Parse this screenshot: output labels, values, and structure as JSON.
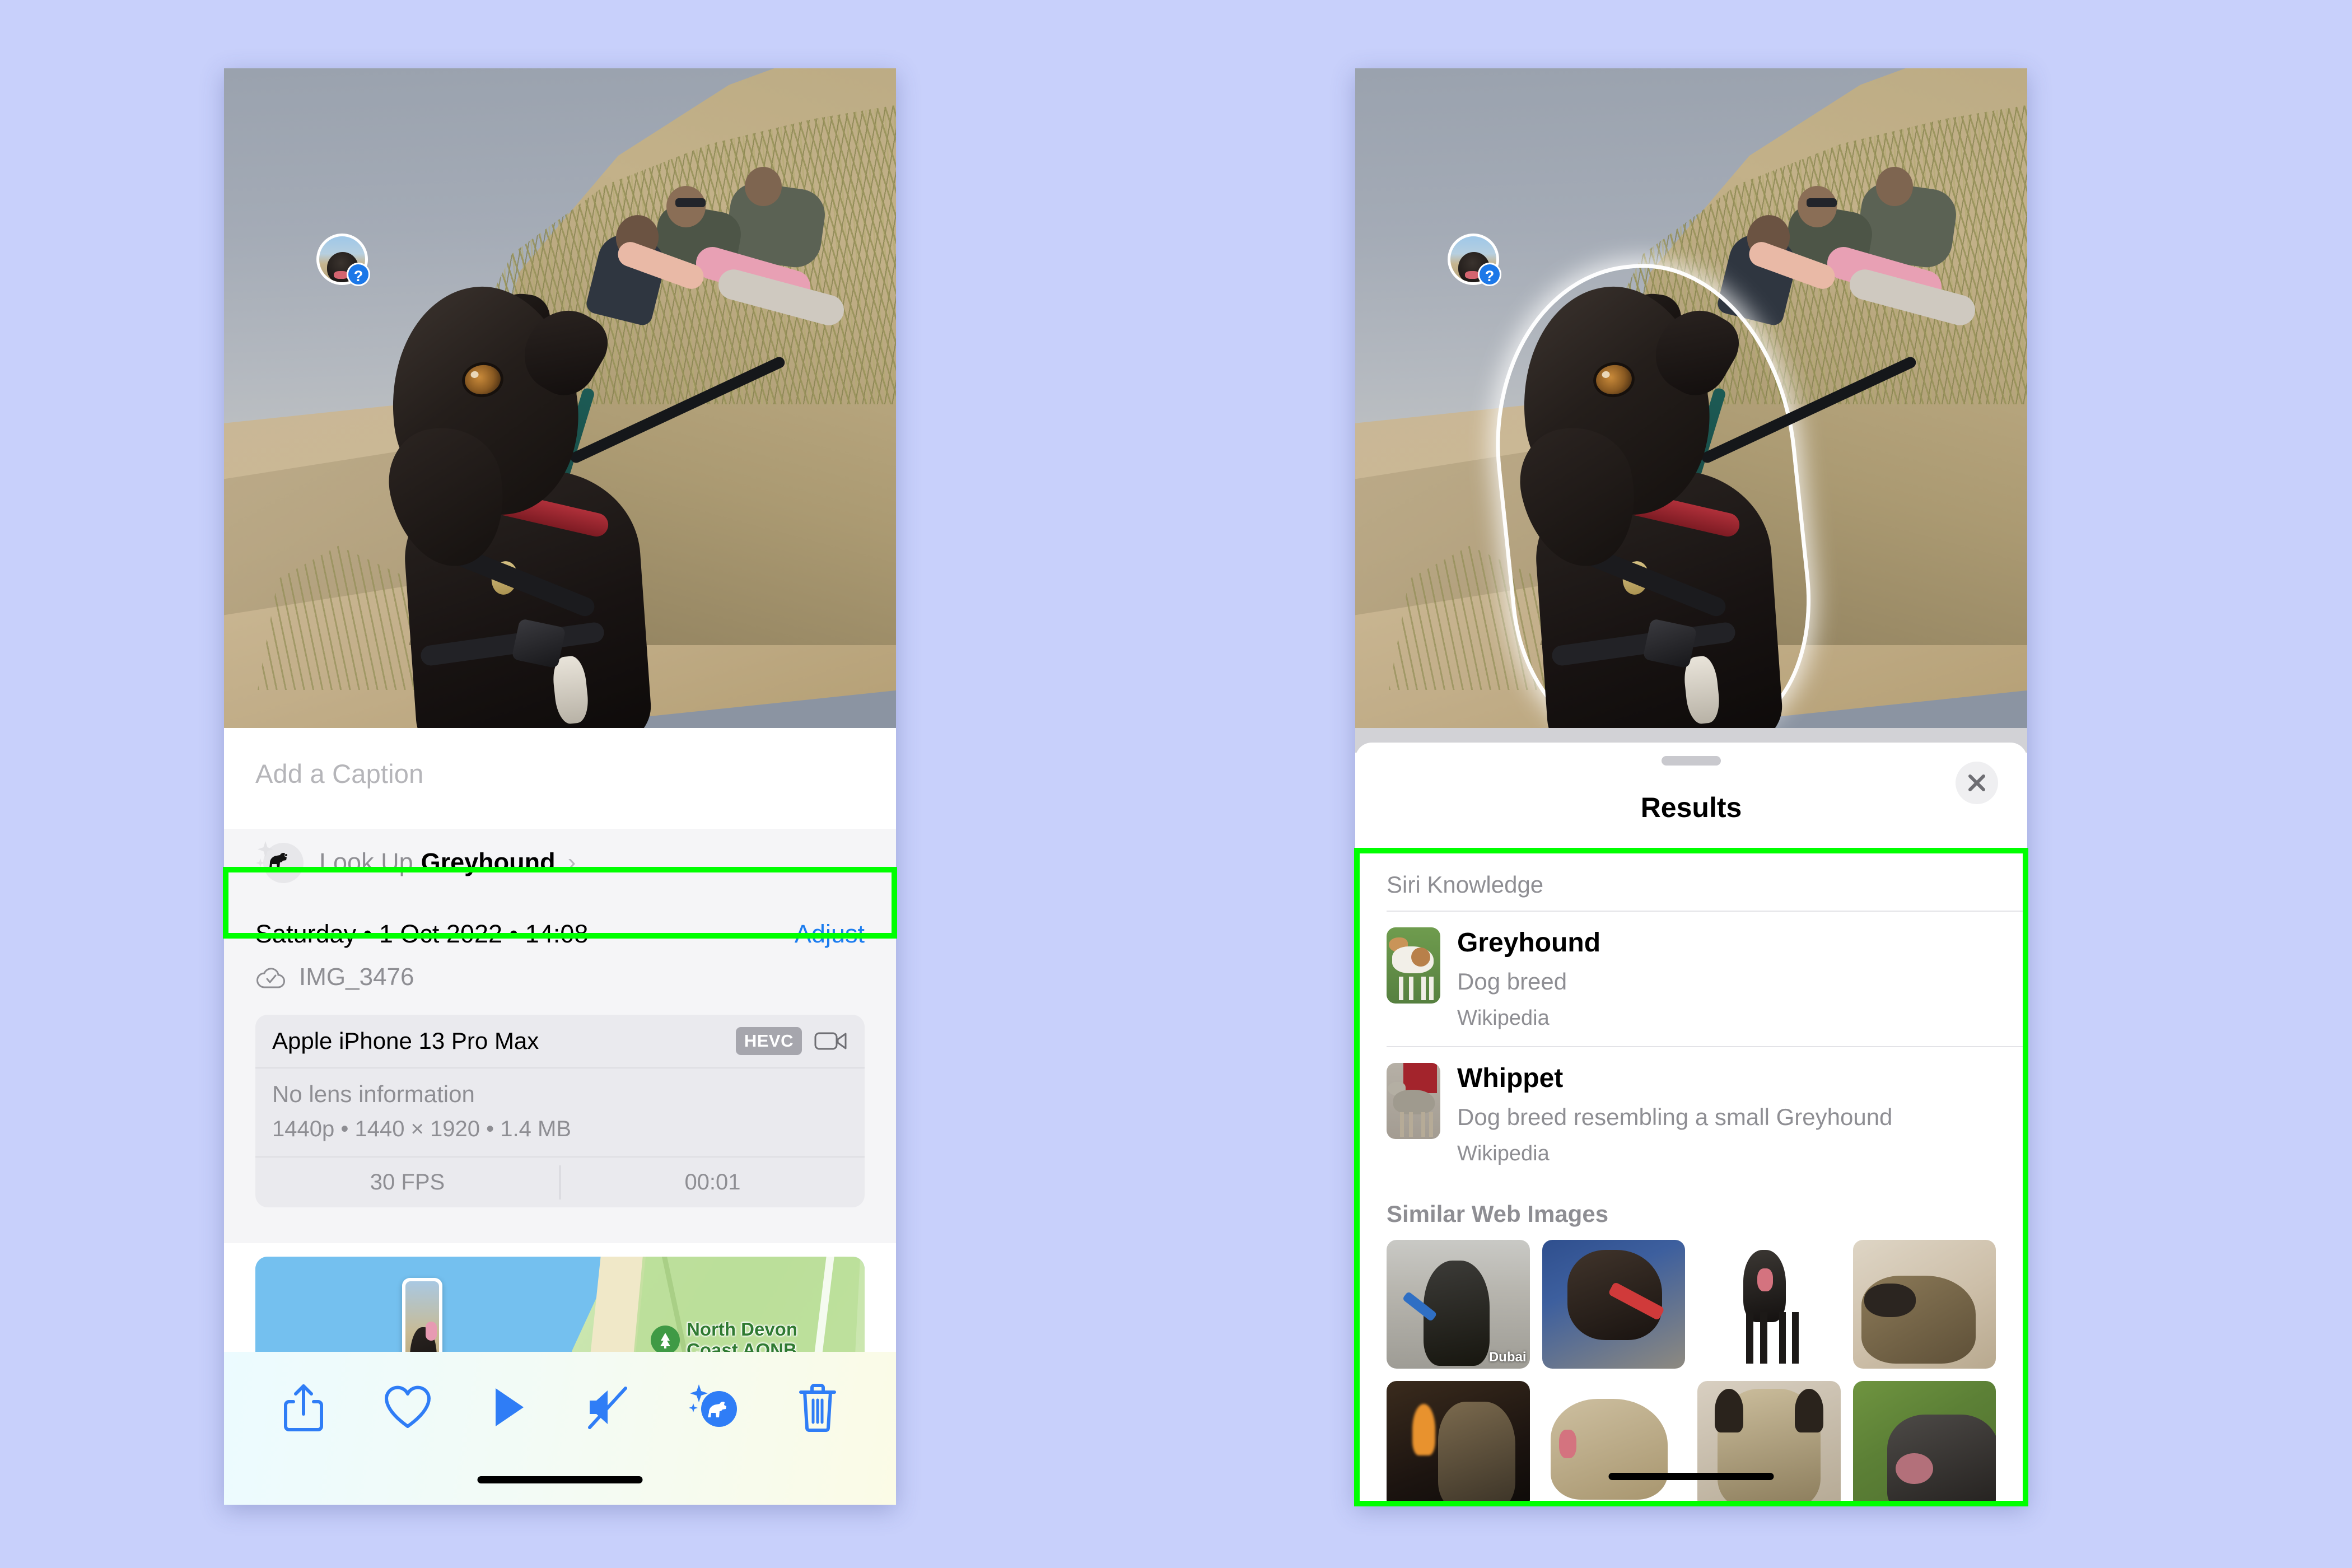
{
  "background_color": "#c8d0fb",
  "highlight_color": "#00ff00",
  "accent_color": "#1b7cef",
  "left_phone": {
    "photo": {
      "pet_badge": {
        "icon": "pet-face-avatar",
        "badge_glyph": "?"
      }
    },
    "caption": {
      "placeholder": "Add a Caption",
      "value": ""
    },
    "look_up": {
      "icon": "dog-sparkle-icon",
      "prefix_label": "Look Up ",
      "subject_label": "Greyhound",
      "chevron": "›"
    },
    "meta": {
      "date_line": "Saturday • 1 Oct 2022 • 14:08",
      "adjust_label": "Adjust",
      "cloud_icon": "icloud-check-icon",
      "filename": "IMG_3476",
      "device_card": {
        "device": "Apple iPhone 13 Pro Max",
        "codec_badge": "HEVC",
        "media_icon": "video-camera-icon",
        "lens_info": "No lens information",
        "resolution_line": "1440p • 1440 × 1920 • 1.4 MB",
        "fps": "30 FPS",
        "duration": "00:01"
      }
    },
    "map": {
      "poi_label": "North Devon\nCoast AONB",
      "poi_icon": "national-park-tree-icon",
      "thumb_alt": "photo-location-thumbnail"
    },
    "toolbar": {
      "items": [
        {
          "name": "share-icon",
          "label": "Share"
        },
        {
          "name": "heart-icon",
          "label": "Favourite"
        },
        {
          "name": "play-icon",
          "label": "Play"
        },
        {
          "name": "speaker-mute-icon",
          "label": "Mute"
        },
        {
          "name": "visual-look-up-dog-icon",
          "label": "Visual Look Up"
        },
        {
          "name": "trash-icon",
          "label": "Delete"
        }
      ],
      "home_indicator": "home-indicator"
    }
  },
  "right_phone": {
    "sheet": {
      "grabber": "sheet-grabber",
      "title": "Results",
      "close_icon": "close-icon"
    },
    "siri_knowledge": {
      "section_title": "Siri Knowledge",
      "rows": [
        {
          "title": "Greyhound",
          "subtitle": "Dog breed",
          "source": "Wikipedia",
          "thumb": "greyhound-standing-on-grass"
        },
        {
          "title": "Whippet",
          "subtitle": "Dog breed resembling a small Greyhound",
          "source": "Wikipedia",
          "thumb": "whippet-standing-on-track"
        }
      ]
    },
    "similar_web_images": {
      "section_title": "Similar Web Images",
      "items": [
        {
          "alt": "black-greyhound-on-blue-lead",
          "caption": "Dubai"
        },
        {
          "alt": "greyhound-with-red-collar-on-mat",
          "caption": ""
        },
        {
          "alt": "black-greyhound-cutout-white-background",
          "caption": ""
        },
        {
          "alt": "brindle-greyhound-lying-on-cushion",
          "caption": ""
        },
        {
          "alt": "greyhound-by-fireplace",
          "caption": ""
        },
        {
          "alt": "fawn-greyhound-yawning",
          "caption": ""
        },
        {
          "alt": "greyhound-face-close-up",
          "caption": ""
        },
        {
          "alt": "black-greyhound-on-grass",
          "caption": ""
        }
      ]
    }
  }
}
